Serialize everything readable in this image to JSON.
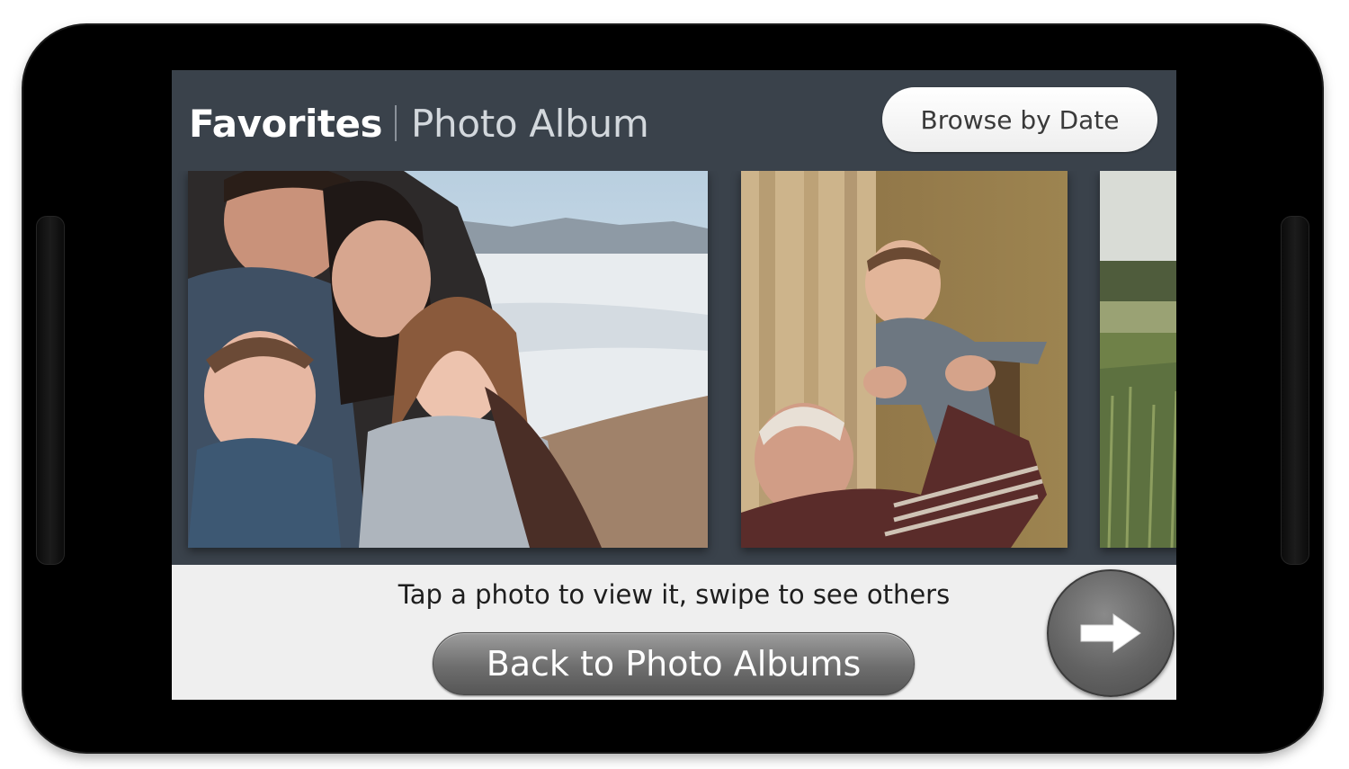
{
  "header": {
    "title_strong": "Favorites",
    "title_light": "Photo Album",
    "browse_label": "Browse by Date"
  },
  "gallery": {
    "photos": [
      {
        "subject": "family-photo"
      },
      {
        "subject": "grandfather-lifting-baby-photo"
      },
      {
        "subject": "grassy-field-photo"
      }
    ]
  },
  "footer": {
    "hint": "Tap a photo to view it, swipe to see others",
    "back_label": "Back to Photo Albums",
    "next_icon": "arrow-right-icon"
  },
  "colors": {
    "screen_bg": "#3a424b",
    "footer_bg": "#efefef",
    "bezel": "#000000",
    "button_gray": "#6e6e6e"
  }
}
